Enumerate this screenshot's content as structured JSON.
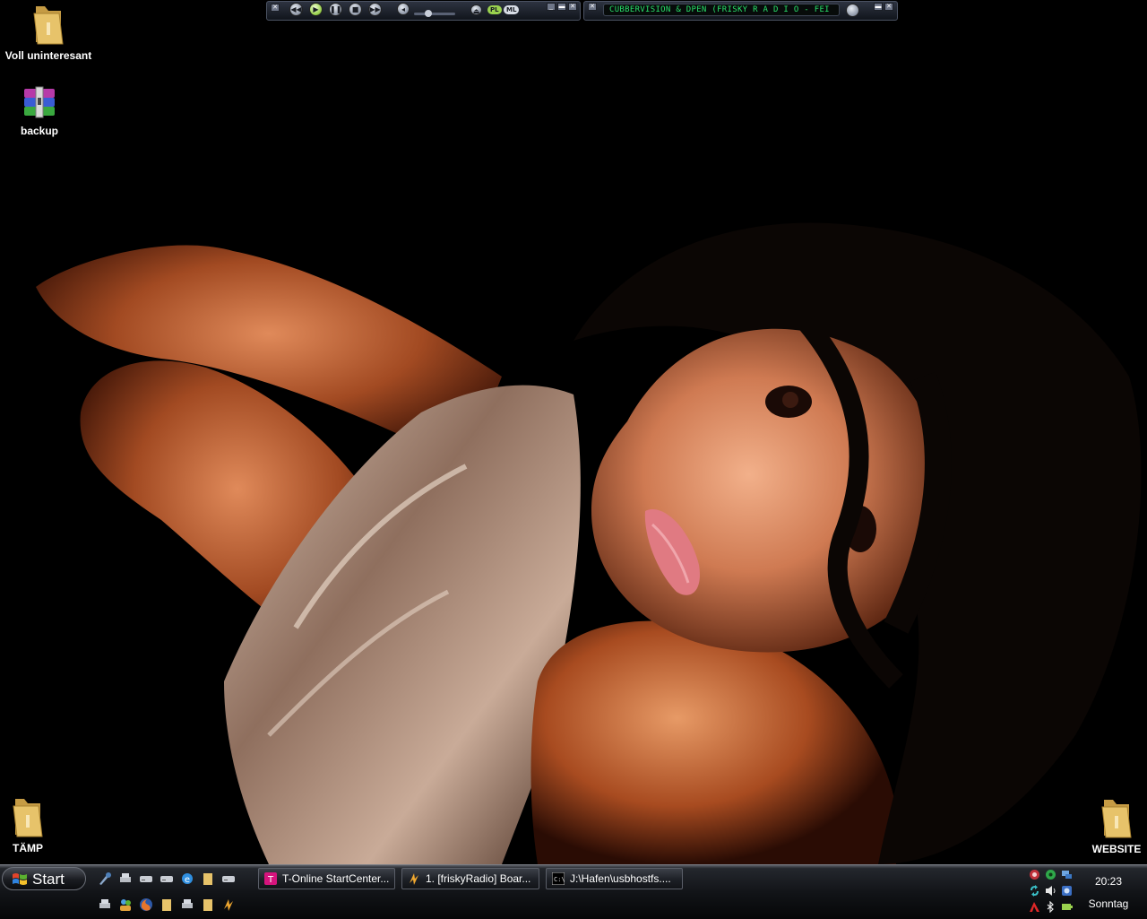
{
  "desktop": {
    "icons": [
      {
        "label": "Voll uninteresant",
        "icon": "folder-icon"
      },
      {
        "label": "backup",
        "icon": "winrar-archive-icon"
      },
      {
        "label": "TÄMP",
        "icon": "folder-icon"
      },
      {
        "label": "WEBSITE",
        "icon": "folder-icon"
      }
    ]
  },
  "winamp": {
    "playlist_ticker": "CUBBERVISION & DPEN (FRISKY R A D I O - FEI",
    "pl_label": "PL",
    "ml_label": "ML",
    "volume": 0.35,
    "buttons": [
      "previous",
      "play",
      "pause",
      "stop",
      "next"
    ]
  },
  "taskbar": {
    "start_label": "Start",
    "tasks": [
      {
        "label": "T-Online StartCenter...",
        "icon": "t-online-icon"
      },
      {
        "label": "1. [friskyRadio] Boar...",
        "icon": "winamp-icon"
      },
      {
        "label": "J:\\Hafen\\usbhostfs....",
        "icon": "cmd-icon"
      }
    ],
    "clock": "20:23",
    "day": "Sonntag"
  },
  "colors": {
    "ticker_text": "#29e06a",
    "taskbar_bg": "#121418",
    "folder_yellow": "#e7c36a"
  }
}
